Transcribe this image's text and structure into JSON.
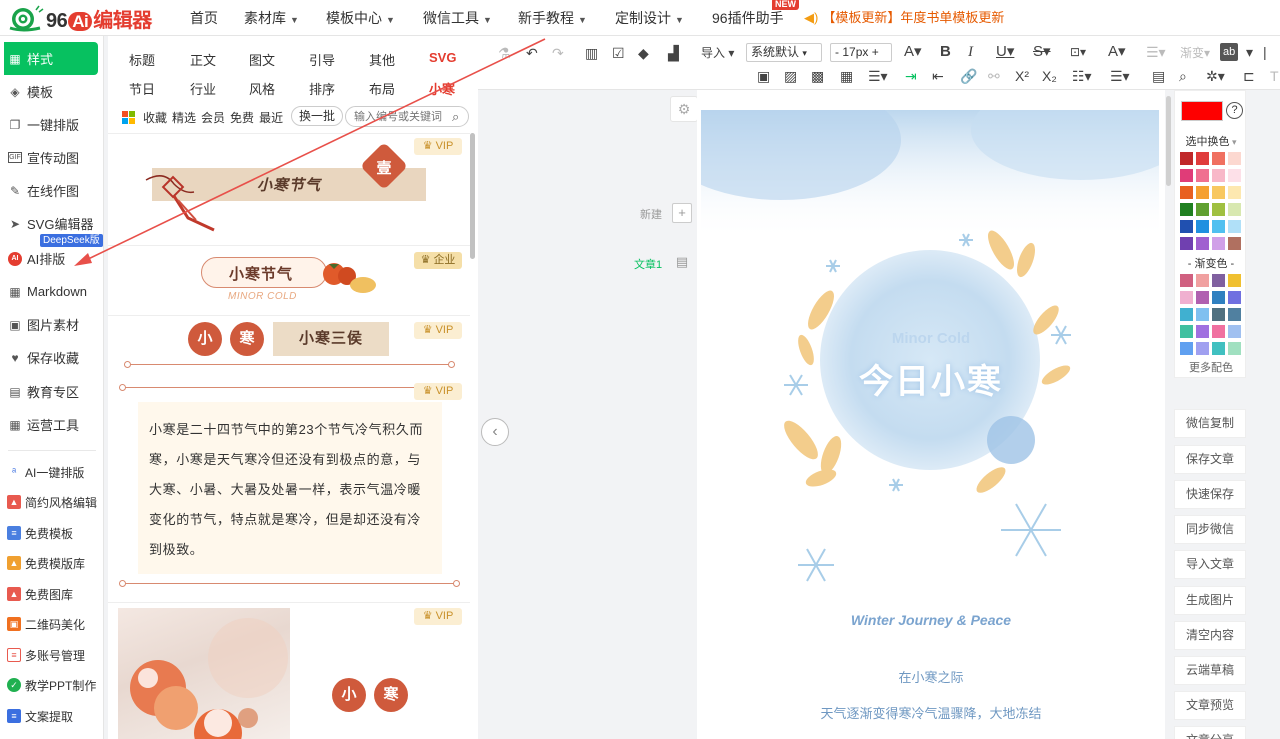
{
  "nav": {
    "logo_num": "96",
    "logo_ai": "Ai",
    "logo_cn": "编辑器",
    "items": [
      {
        "label": "首页",
        "dd": false
      },
      {
        "label": "素材库",
        "dd": true
      },
      {
        "label": "模板中心",
        "dd": true
      },
      {
        "label": "微信工具",
        "dd": true
      },
      {
        "label": "新手教程",
        "dd": true
      },
      {
        "label": "定制设计",
        "dd": true
      },
      {
        "label": "96插件助手",
        "dd": false
      }
    ],
    "new_badge": "NEW",
    "announcement": "【模板更新】年度书单模板更新"
  },
  "sidebar": {
    "items": [
      {
        "label": "样式",
        "icon": "grid-icon"
      },
      {
        "label": "模板",
        "icon": "layers-icon"
      },
      {
        "label": "一键排版",
        "icon": "copy-icon"
      },
      {
        "label": "宣传动图",
        "icon": "gif-icon"
      },
      {
        "label": "在线作图",
        "icon": "edit-icon"
      },
      {
        "label": "SVG编辑器",
        "icon": "cursor-icon"
      },
      {
        "label": "AI排版",
        "icon": "ai-icon"
      },
      {
        "label": "Markdown",
        "icon": "grid-icon"
      },
      {
        "label": "图片素材",
        "icon": "image-icon"
      },
      {
        "label": "保存收藏",
        "icon": "heart-icon"
      },
      {
        "label": "教育专区",
        "icon": "book-icon"
      },
      {
        "label": "运营工具",
        "icon": "grid-icon"
      }
    ],
    "deepseek_badge": "DeepSeek版",
    "tools": [
      {
        "label": "AI一键排版",
        "color": "#3b6fe0",
        "icon": "ai-wand-icon"
      },
      {
        "label": "简约风格编辑",
        "color": "#e85a4f",
        "icon": "picture-icon"
      },
      {
        "label": "免费模板",
        "color": "#4a7fe0",
        "icon": "doc-icon"
      },
      {
        "label": "免费模版库",
        "color": "#f0a030",
        "icon": "gallery-icon"
      },
      {
        "label": "免费图库",
        "color": "#e85a4f",
        "icon": "photo-icon"
      },
      {
        "label": "二维码美化",
        "color": "#f07020",
        "icon": "qr-icon"
      },
      {
        "label": "多账号管理",
        "color": "#e85a4f",
        "icon": "account-icon"
      },
      {
        "label": "教学PPT制作",
        "color": "#20b050",
        "icon": "check-icon"
      },
      {
        "label": "文案提取",
        "color": "#3b6fe0",
        "icon": "text-icon"
      }
    ]
  },
  "material": {
    "tabs_row1": [
      "标题",
      "正文",
      "图文",
      "引导",
      "其他",
      "SVG"
    ],
    "tabs_row2": [
      "节日",
      "行业",
      "风格",
      "排序",
      "布局",
      "小寒"
    ],
    "filters": [
      "收藏",
      "精选",
      "会员",
      "免费",
      "最近"
    ],
    "swap_label": "换一批",
    "search_placeholder": "输入编号或关键词",
    "cards": {
      "c1_title": "小寒节气",
      "c1_badge": "壹",
      "c1_tag": "VIP",
      "c2_title": "小寒节气",
      "c2_sub": "MINOR COLD",
      "c2_tag": "企业",
      "c3_char1": "小",
      "c3_char2": "寒",
      "c3_title": "小寒三侯",
      "c3_tag": "VIP",
      "c4_text": "小寒是二十四节气中的第23个节气冷气积久而寒，小寒是天气寒冷但还没有到极点的意，与大寒、小暑、大暑及处暑一样，表示气温冷暖变化的节气，特点就是寒冷，但是却还没有冷到极致。",
      "c4_tag": "VIP",
      "c5_char1": "小",
      "c5_char2": "寒",
      "c5_tag": "VIP"
    }
  },
  "toolbar": {
    "import": "导入",
    "font": "系统默认",
    "font_size": "17px"
  },
  "editor": {
    "new_label": "新建",
    "article_label": "文章1",
    "cover_en": "Minor Cold",
    "cover_cn": "今日小寒",
    "journey": "Winter Journey & Peace",
    "line1": "在小寒之际",
    "line2": "天气逐渐变得寒冷气温骤降，大地冻结"
  },
  "colors": {
    "current": "#fe0000",
    "select_label": "选中换色",
    "gradient_label": "- 渐变色 -",
    "more_label": "更多配色",
    "solid": [
      "#c0282a",
      "#e03c3c",
      "#f07060",
      "#fcd8d0",
      "#e03c78",
      "#f07090",
      "#f8b8c8",
      "#fde0e8",
      "#e86020",
      "#f5a030",
      "#f8c860",
      "#fde8b0",
      "#208020",
      "#60a030",
      "#a0c040",
      "#d8e8b0",
      "#2050b0",
      "#2090e0",
      "#50c0f0",
      "#b0e0f8",
      "#7040b0",
      "#a060d0",
      "#d0a0e8",
      "#b07060"
    ],
    "gradient": [
      "#d06080",
      "#f0a0a0",
      "#8060a0",
      "#f0c030",
      "#f0b0d0",
      "#b060b0",
      "#3080c0",
      "#7070e0",
      "#40b0d0",
      "#80c0f0",
      "#507080",
      "#5080a0",
      "#40c0a0",
      "#a070e0",
      "#f070a0",
      "#a0c0f0",
      "#60a0f0",
      "#a0a0f0",
      "#40c0c0",
      "#a0e0c0"
    ]
  },
  "actions": [
    "微信复制",
    "保存文章",
    "快速保存",
    "同步微信",
    "导入文章",
    "生成图片",
    "清空内容",
    "云端草稿",
    "文章预览",
    "文章分享"
  ]
}
